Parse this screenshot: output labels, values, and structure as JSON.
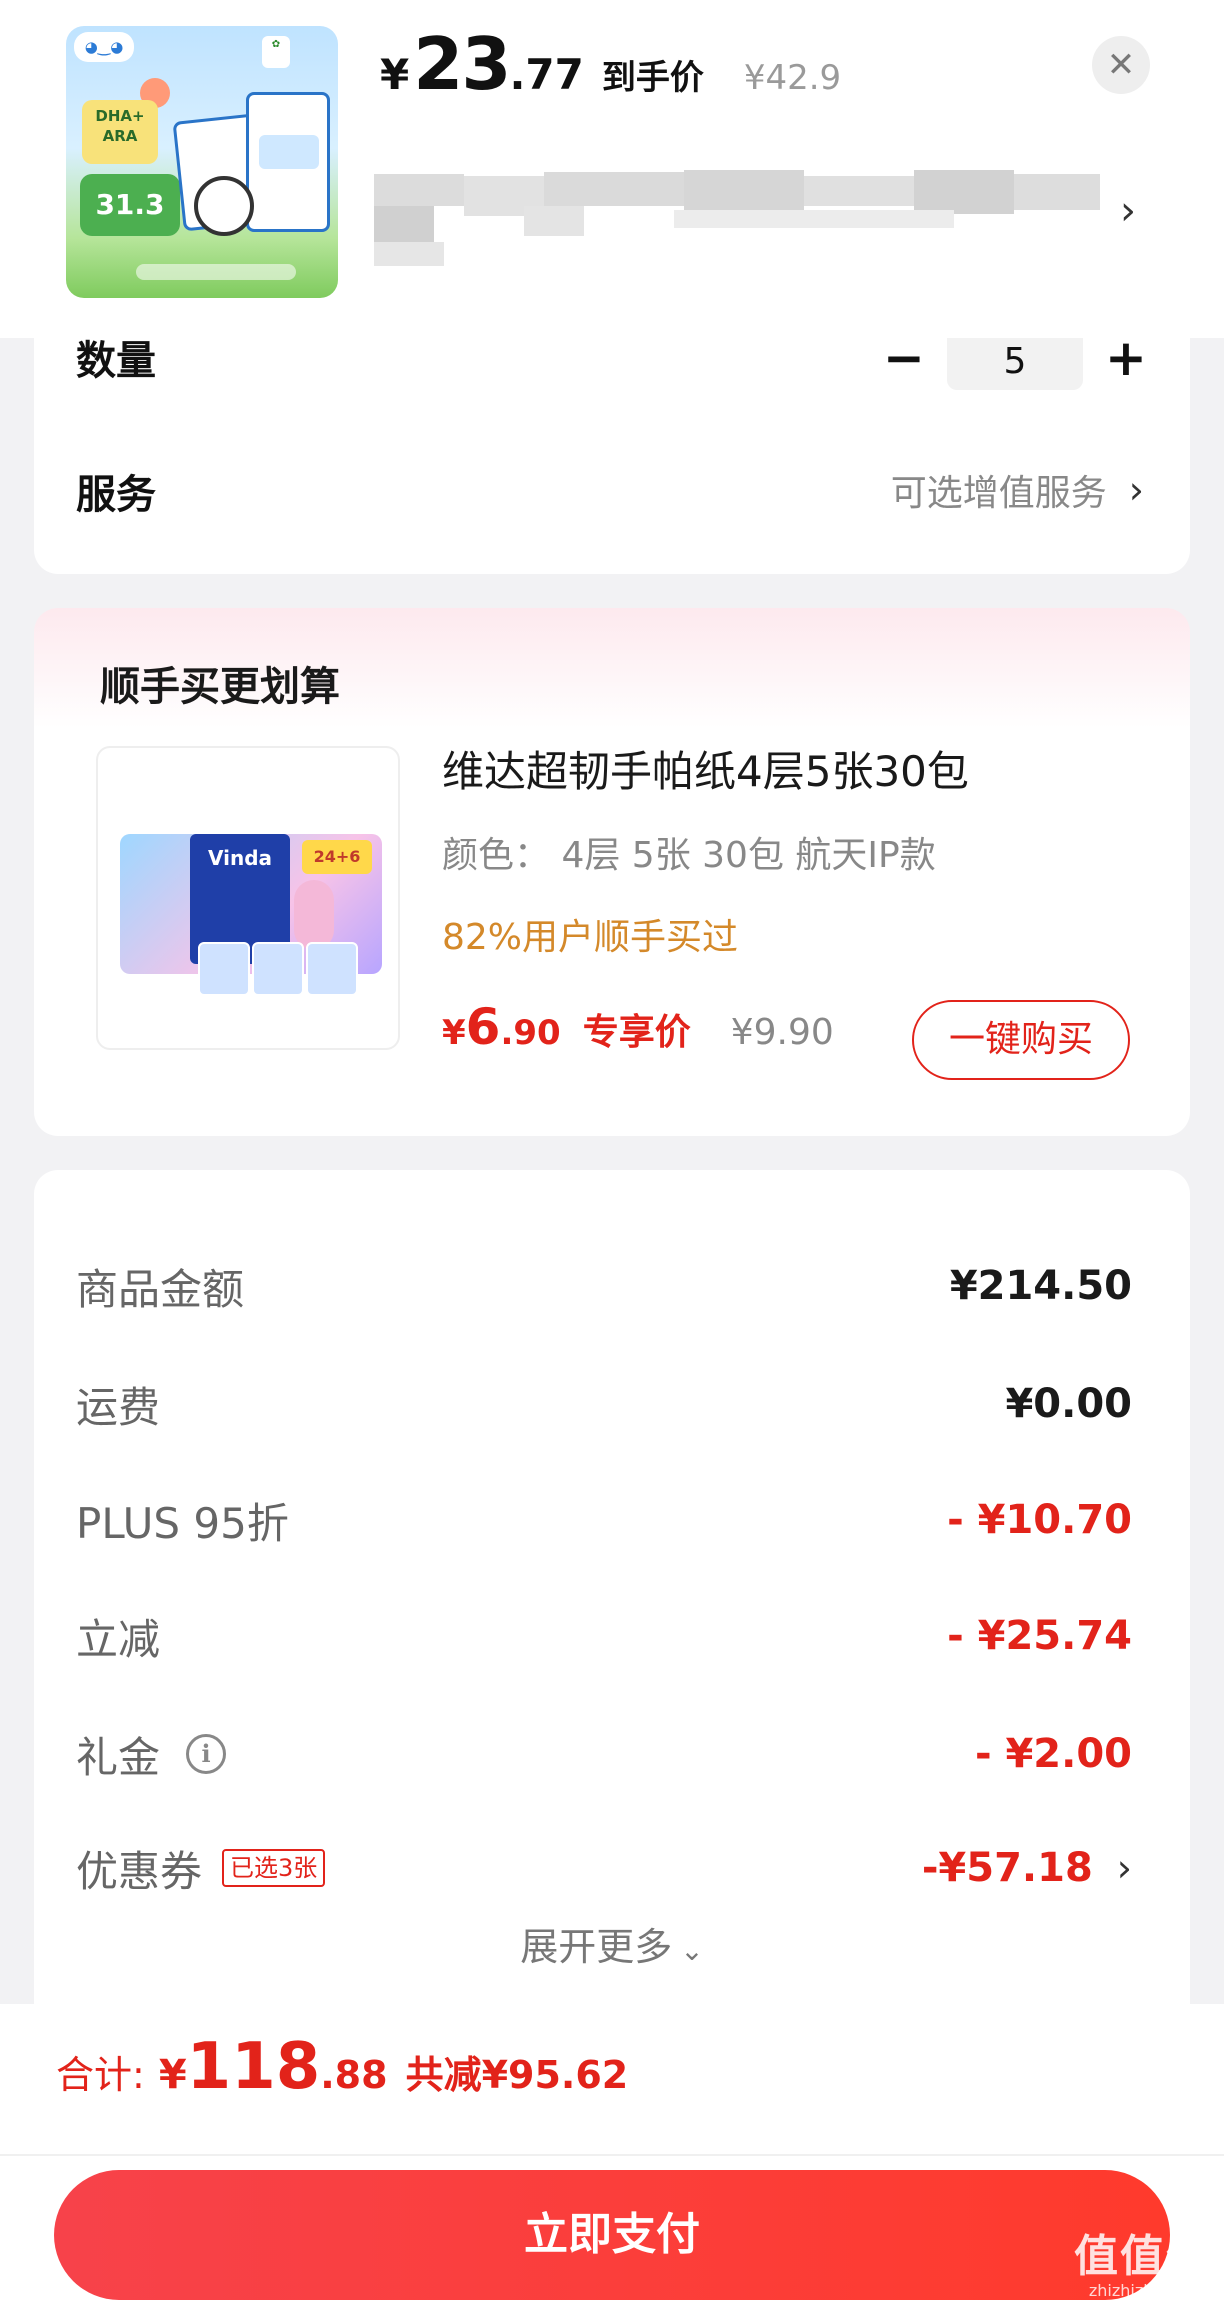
{
  "header": {
    "price_currency": "¥",
    "price_integer": "23",
    "price_decimal": ".77",
    "price_tag": "到手价",
    "original_price": "¥42.9",
    "thumbnail_badge": "31.3",
    "thumbnail_text": "DHA+ ARA"
  },
  "quantity": {
    "label": "数量",
    "minus": "−",
    "value": "5",
    "plus": "+"
  },
  "service": {
    "label": "服务",
    "hint": "可选增值服务",
    "chevron": "›"
  },
  "bundle": {
    "title": "顺手买更划算",
    "product_name": "维达超韧手帕纸4层5张30包",
    "color_spec": "颜色： 4层 5张 30包 航天IP款",
    "users_bought": "82%用户顺手买过",
    "price_currency": "¥",
    "price_integer": "6",
    "price_decimal": ".90",
    "price_tag": "专享价",
    "original_price": "¥9.90",
    "buy_button": "一键购买",
    "image_brand": "Vinda",
    "image_badge": "24+6"
  },
  "breakdown": {
    "rows": [
      {
        "label": "商品金额",
        "value": "¥214.50"
      },
      {
        "label": "运费",
        "value": "¥0.00"
      },
      {
        "label": "PLUS 95折",
        "value": "- ¥10.70"
      },
      {
        "label": "立减",
        "value": "- ¥25.74"
      },
      {
        "label": "礼金",
        "value": "- ¥2.00"
      },
      {
        "label": "优惠券",
        "value": "-¥57.18"
      }
    ],
    "coupon_badge": "已选3张",
    "info_icon_glyph": "i",
    "expand_label": "展开更多",
    "expand_chevron": "⌄"
  },
  "bottom": {
    "total_label": "合计:",
    "total_currency": "¥",
    "total_integer": "118",
    "total_decimal": ".88",
    "saved": "共减¥95.62",
    "pay_button": "立即支付"
  },
  "watermark": {
    "main": "值值值",
    "sub": "zhizhizhi.com"
  },
  "colors": {
    "accent_red": "#e2231a",
    "orange_hint": "#d4892a",
    "pay_gradient_start": "#f7424a",
    "pay_gradient_end": "#ff3a2c"
  },
  "icons": [
    "close-icon",
    "chevron-right-icon",
    "info-icon",
    "chevron-down-icon"
  ]
}
